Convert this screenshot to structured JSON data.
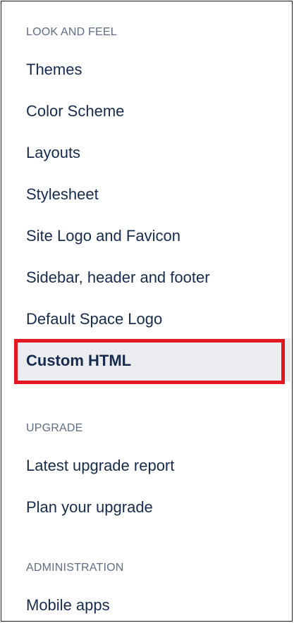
{
  "sections": [
    {
      "heading": "LOOK AND FEEL",
      "items": [
        {
          "label": "Themes"
        },
        {
          "label": "Color Scheme"
        },
        {
          "label": "Layouts"
        },
        {
          "label": "Stylesheet"
        },
        {
          "label": "Site Logo and Favicon"
        },
        {
          "label": "Sidebar, header and footer"
        },
        {
          "label": "Default Space Logo"
        },
        {
          "label": "Custom HTML",
          "active": true
        }
      ]
    },
    {
      "heading": "UPGRADE",
      "items": [
        {
          "label": "Latest upgrade report"
        },
        {
          "label": "Plan your upgrade"
        }
      ]
    },
    {
      "heading": "ADMINISTRATION",
      "items": [
        {
          "label": "Mobile apps"
        }
      ]
    }
  ],
  "colors": {
    "highlight_border": "#e41620",
    "active_background": "#ebecf0",
    "heading_text": "#5e6c84",
    "item_text": "#172b4d"
  }
}
